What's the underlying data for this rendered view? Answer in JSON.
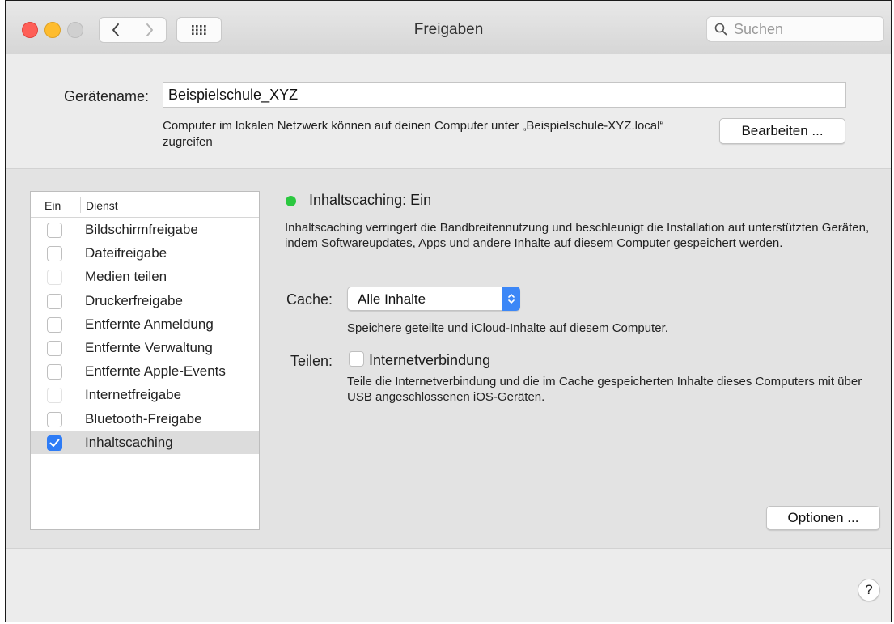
{
  "window": {
    "title": "Freigaben",
    "search_placeholder": "Suchen"
  },
  "device": {
    "label": "Gerätename:",
    "value": "Beispielschule_XYZ",
    "description": "Computer im lokalen Netzwerk können auf deinen Computer unter „Beispielschule-XYZ.local“ zugreifen",
    "edit_button": "Bearbeiten ..."
  },
  "services": {
    "header_on": "Ein",
    "header_service": "Dienst",
    "items": [
      {
        "label": "Bildschirmfreigabe",
        "checked": false,
        "enabled": true
      },
      {
        "label": "Dateifreigabe",
        "checked": false,
        "enabled": true
      },
      {
        "label": "Medien teilen",
        "checked": false,
        "enabled": false
      },
      {
        "label": "Druckerfreigabe",
        "checked": false,
        "enabled": true
      },
      {
        "label": "Entfernte Anmeldung",
        "checked": false,
        "enabled": true
      },
      {
        "label": "Entfernte Verwaltung",
        "checked": false,
        "enabled": true
      },
      {
        "label": "Entfernte Apple-Events",
        "checked": false,
        "enabled": true
      },
      {
        "label": "Internetfreigabe",
        "checked": false,
        "enabled": false
      },
      {
        "label": "Bluetooth-Freigabe",
        "checked": false,
        "enabled": true
      },
      {
        "label": "Inhaltscaching",
        "checked": true,
        "enabled": true,
        "selected": true
      }
    ]
  },
  "detail": {
    "status": "Inhaltscaching: Ein",
    "status_color": "#2bc840",
    "description": "Inhaltscaching verringert die Bandbreitennutzung und beschleunigt die Installation auf unterstützten Geräten, indem Softwareupdates, Apps und andere Inhalte auf diesem Computer gespeichert werden.",
    "cache_label": "Cache:",
    "cache_value": "Alle Inhalte",
    "cache_hint": "Speichere geteilte und iCloud-Inhalte auf diesem Computer.",
    "share_label": "Teilen:",
    "share_option": "Internetverbindung",
    "share_checked": false,
    "share_hint": "Teile die Internetverbindung und die im Cache gespeicherten Inhalte dieses Computers mit über USB angeschlossenen iOS-Geräten.",
    "options_button": "Optionen ..."
  },
  "help_label": "?",
  "colors": {
    "accent": "#2e7cf6",
    "status_on": "#2bc840",
    "close": "#fe5f57",
    "minimize": "#febc2e"
  },
  "icons": [
    "back-icon",
    "forward-icon",
    "show-all-grid-icon",
    "search-icon",
    "checkmark-icon",
    "updown-chevron-icon",
    "help-icon"
  ]
}
